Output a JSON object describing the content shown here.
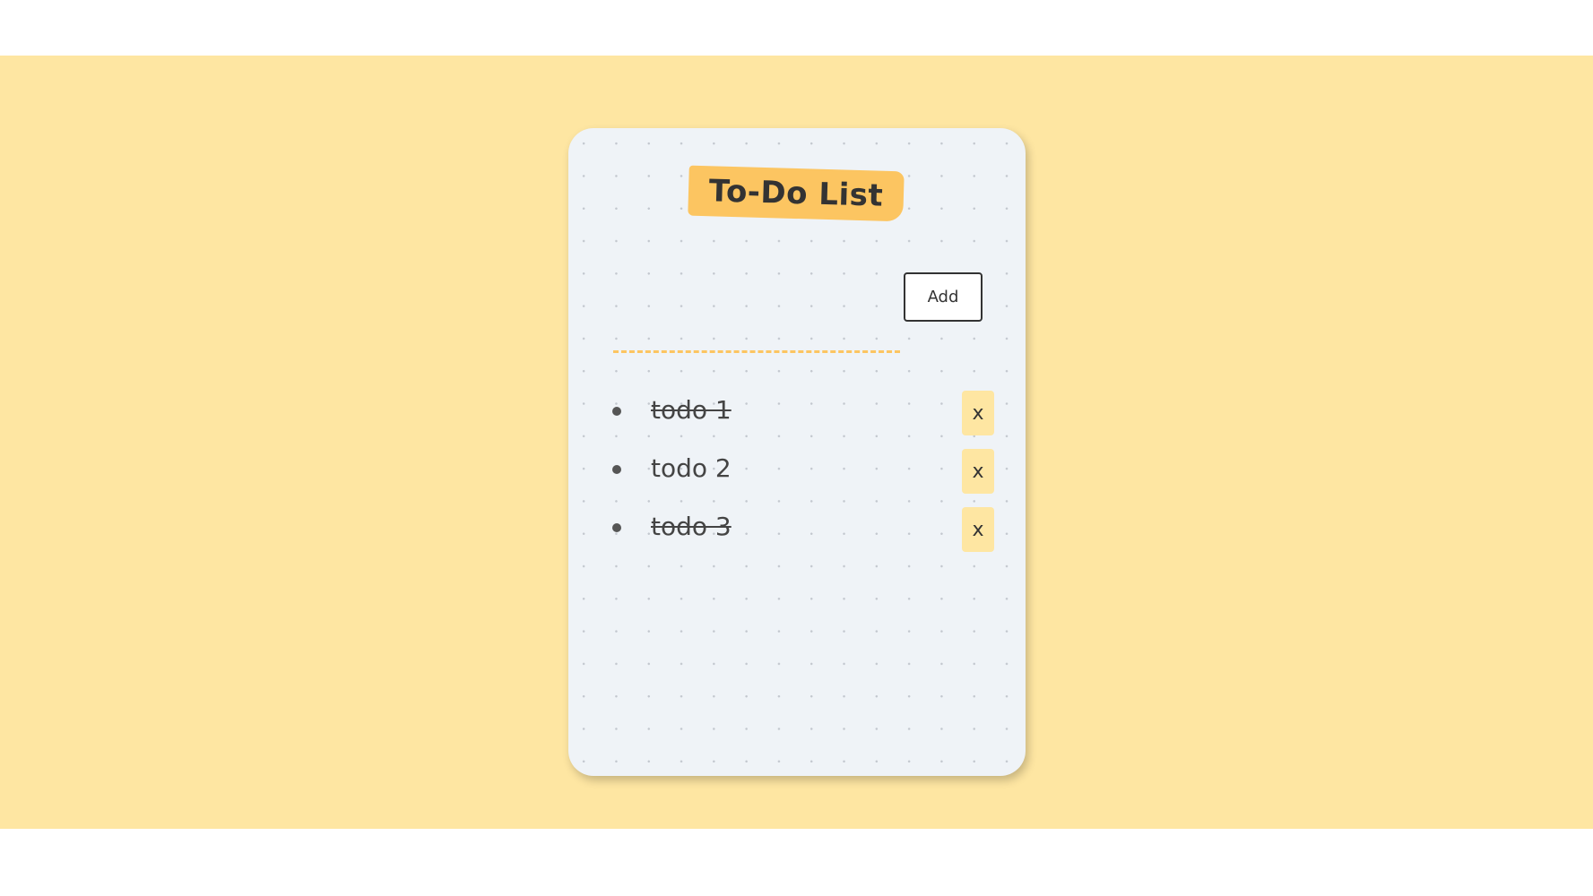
{
  "app": {
    "title": "To-Do List"
  },
  "input": {
    "value": "",
    "placeholder": ""
  },
  "add_button": {
    "label": "Add"
  },
  "todos": [
    {
      "text": "todo 1",
      "done": true,
      "delete_label": "x"
    },
    {
      "text": "todo 2",
      "done": false,
      "delete_label": "x"
    },
    {
      "text": "todo 3",
      "done": true,
      "delete_label": "x"
    }
  ],
  "colors": {
    "background": "#fee6a2",
    "card": "#eff3f7",
    "accent": "#fcc561",
    "text": "#444444"
  }
}
